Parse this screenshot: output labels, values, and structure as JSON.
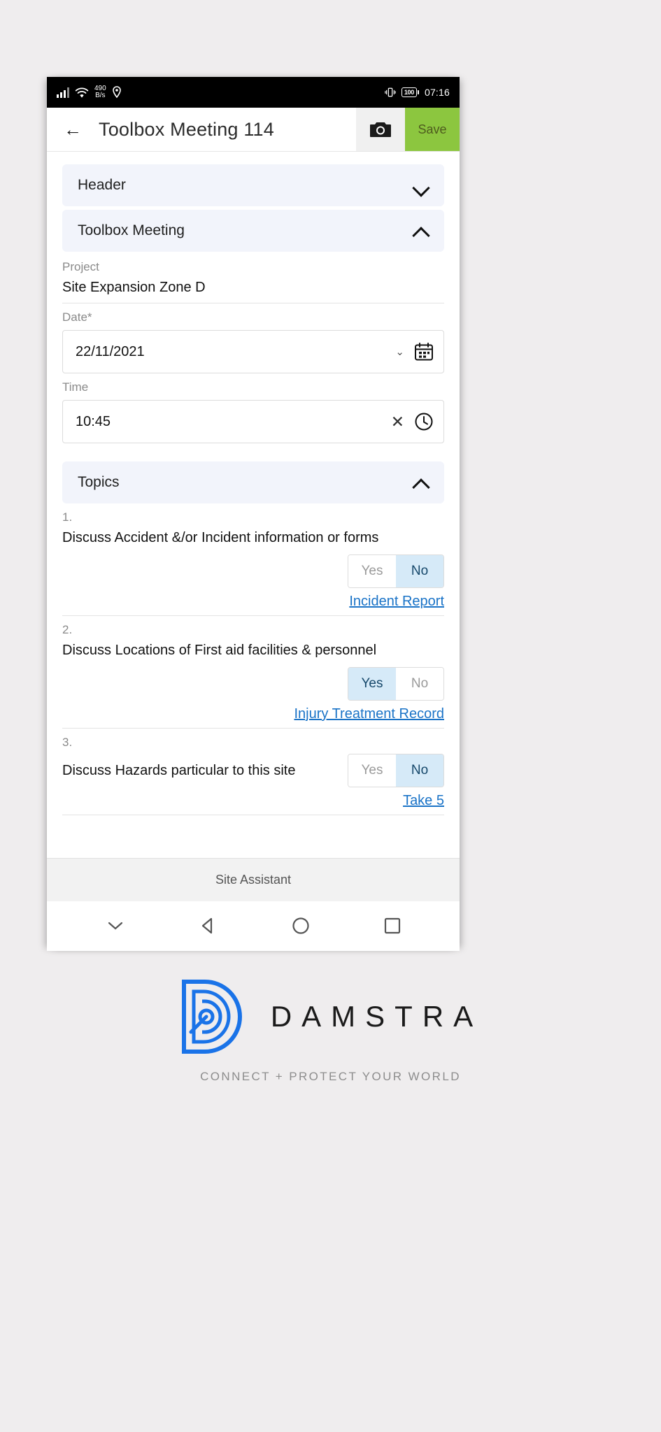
{
  "status_bar": {
    "network_speed_value": "490",
    "network_speed_unit": "B/s",
    "battery": "100",
    "time": "07:16",
    "icons": [
      "signal-bars-icon",
      "wifi-icon",
      "location-pin-icon",
      "vibrate-icon",
      "battery-icon"
    ]
  },
  "app_bar": {
    "back_icon": "back-arrow-icon",
    "title": "Toolbox Meeting 114",
    "camera_icon": "camera-icon",
    "save_label": "Save",
    "save_color": "#8cc63f"
  },
  "sections": {
    "header": {
      "label": "Header",
      "expanded": false,
      "chevron": "chevron-down-icon"
    },
    "toolbox_meeting": {
      "label": "Toolbox Meeting",
      "expanded": true,
      "chevron": "chevron-up-icon"
    },
    "topics": {
      "label": "Topics",
      "expanded": true,
      "chevron": "chevron-up-icon"
    }
  },
  "form": {
    "project": {
      "label": "Project",
      "value": "Site Expansion Zone D"
    },
    "date": {
      "label": "Date*",
      "value": "22/11/2021",
      "icons": [
        "chevron-down-icon",
        "calendar-icon"
      ]
    },
    "time": {
      "label": "Time",
      "value": "10:45",
      "icons": [
        "clear-icon",
        "clock-icon"
      ]
    }
  },
  "topics": [
    {
      "number": "1.",
      "text": "Discuss Accident &/or Incident information or forms",
      "yes_label": "Yes",
      "no_label": "No",
      "selected": "No",
      "link": "Incident Report"
    },
    {
      "number": "2.",
      "text": "Discuss Locations of First aid facilities & personnel",
      "yes_label": "Yes",
      "no_label": "No",
      "selected": "Yes",
      "link": "Injury Treatment Record"
    },
    {
      "number": "3.",
      "text": "Discuss Hazards particular to this site",
      "yes_label": "Yes",
      "no_label": "No",
      "selected": "No",
      "link": "Take 5"
    }
  ],
  "bottom_bar": {
    "label": "Site Assistant"
  },
  "nav_bar": {
    "collapse_icon": "chevron-down-icon",
    "back_icon": "triangle-back-icon",
    "home_icon": "circle-home-icon",
    "recents_icon": "square-recents-icon"
  },
  "brand": {
    "logo_icon": "damstra-logo-icon",
    "name": "DAMSTRA",
    "tagline": "CONNECT + PROTECT YOUR WORLD",
    "logo_color": "#1a73e8"
  },
  "colors": {
    "accent_green": "#8cc63f",
    "link_blue": "#1a73c7",
    "selected_blue": "#d6eaf8",
    "accordion_bg": "#f2f4fb"
  }
}
